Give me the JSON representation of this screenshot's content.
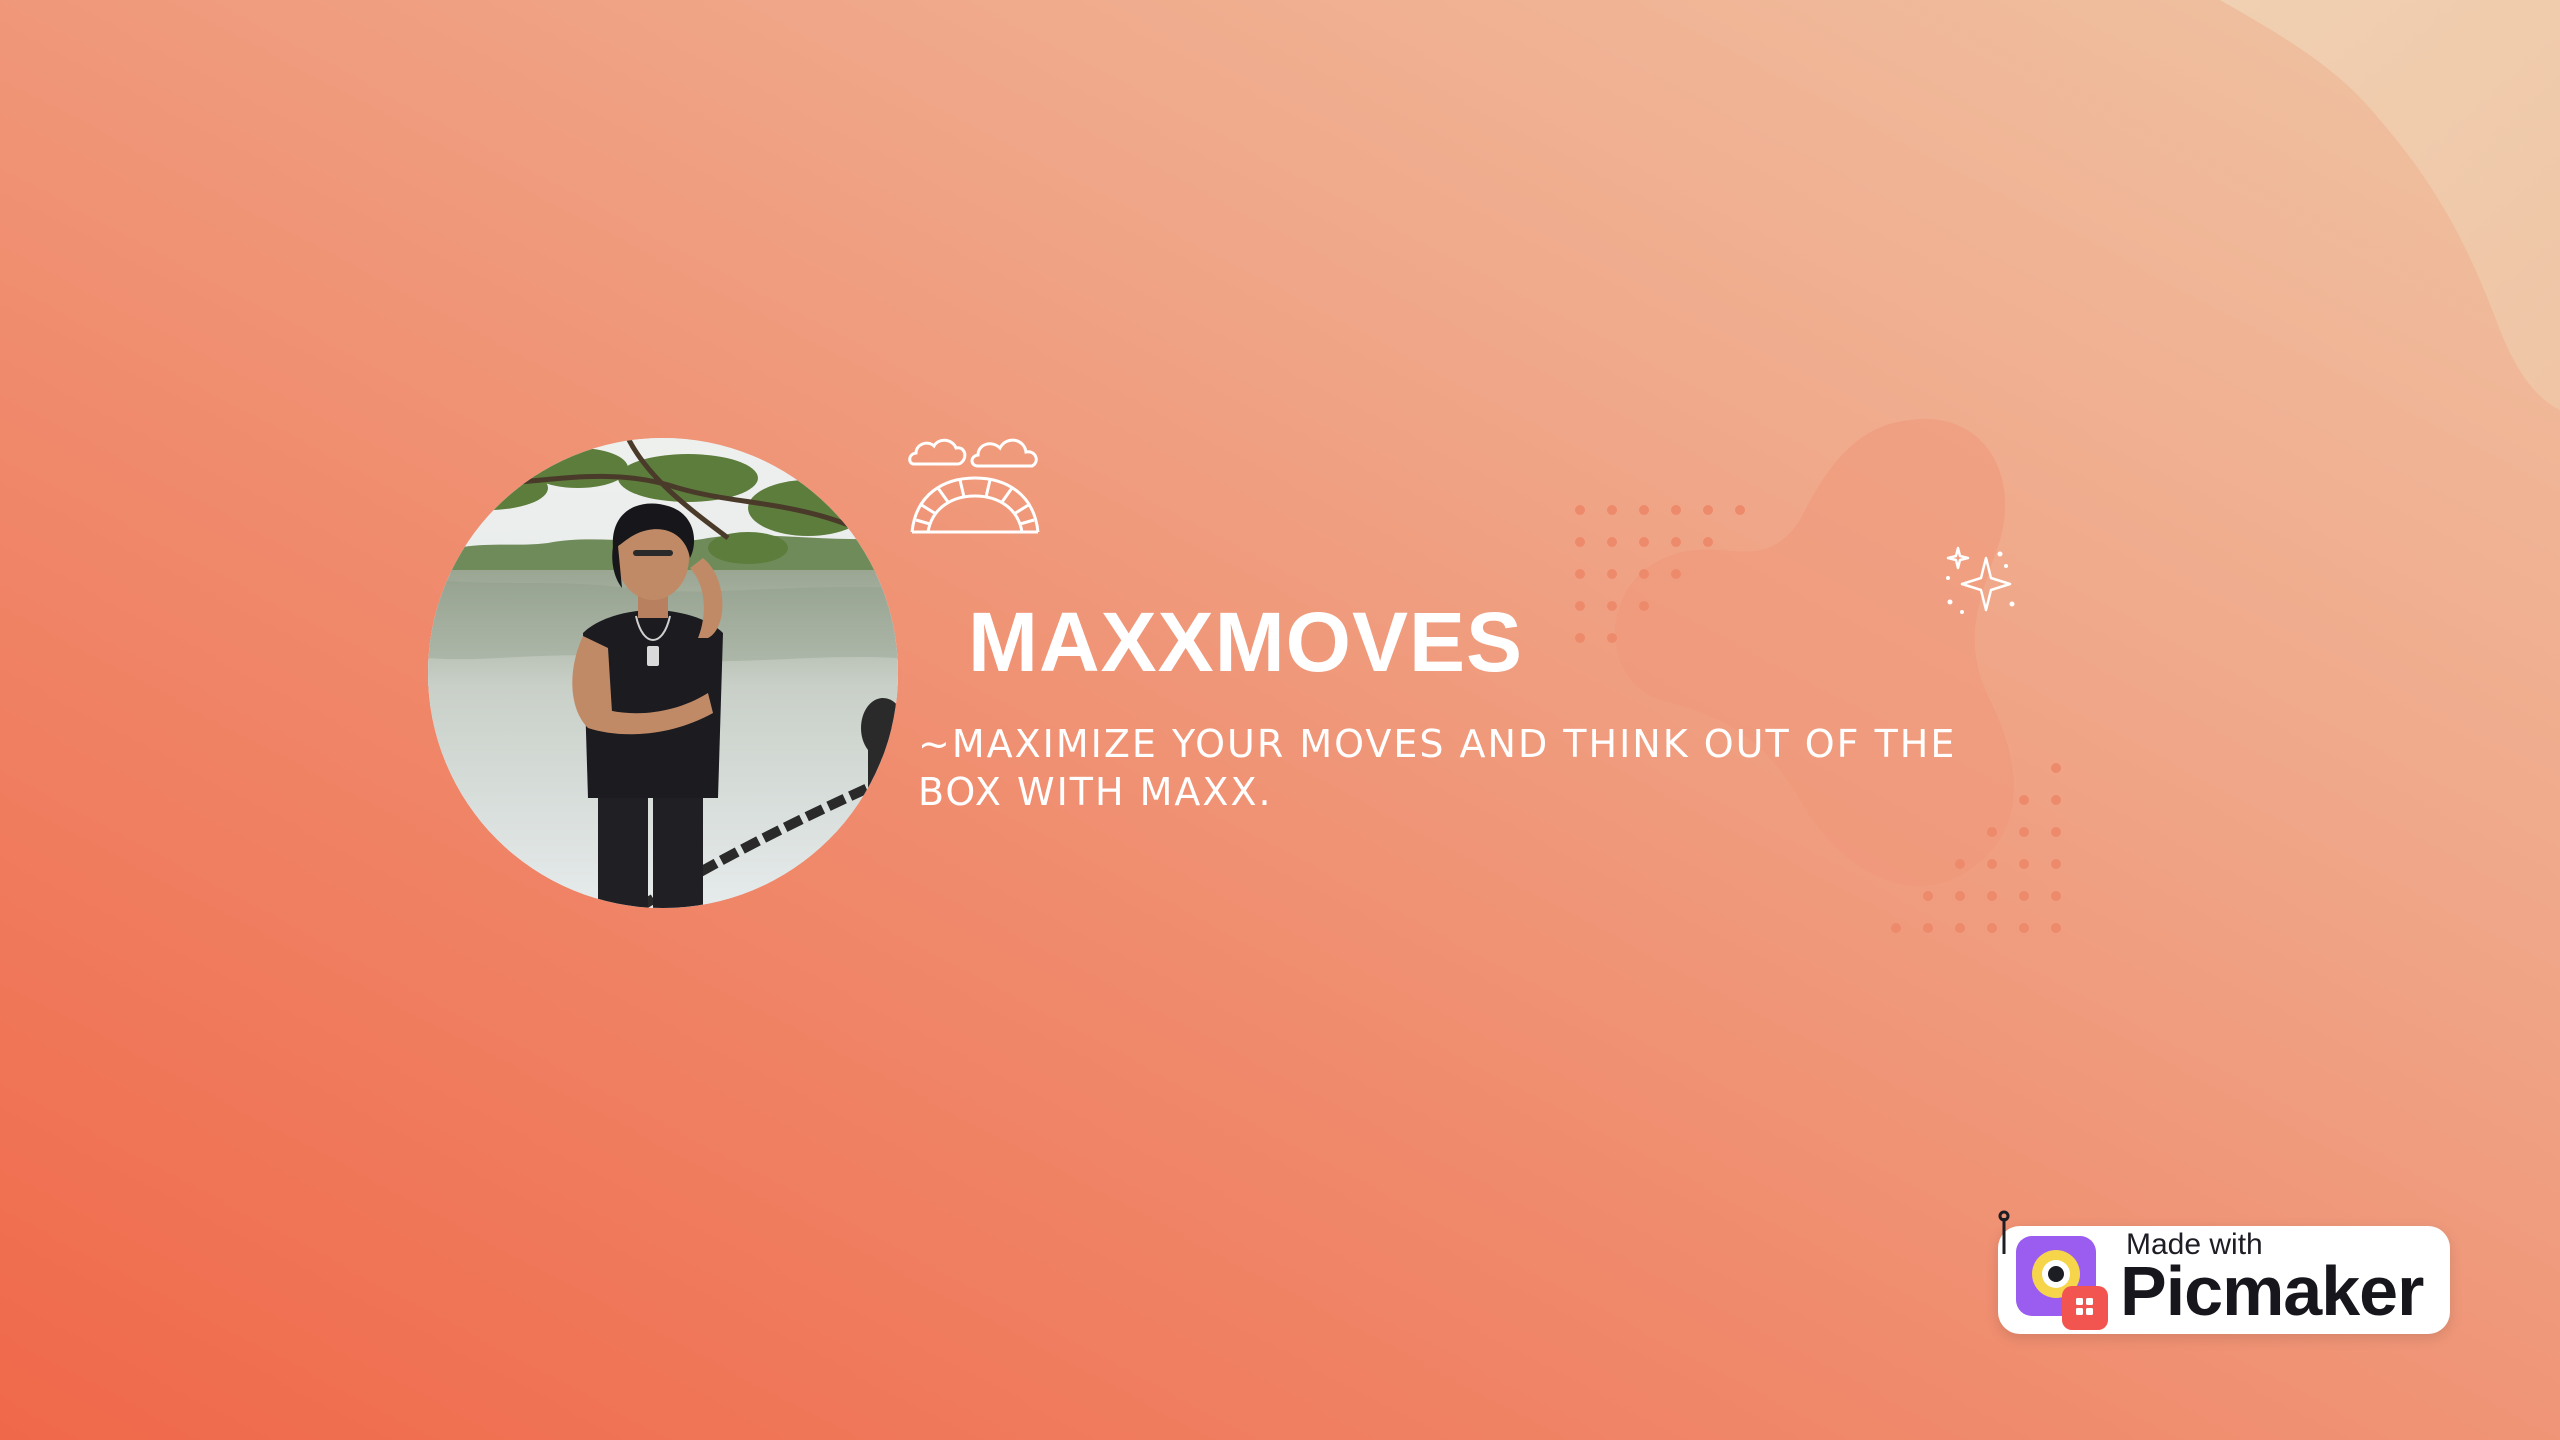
{
  "banner": {
    "title": "MAXXMOVES",
    "tagline": "~MAXIMIZE YOUR MOVES AND THINK OUT OF THE BOX WITH MAXX."
  },
  "watermark": {
    "small_text": "Made with",
    "brand_text": "Picmaker"
  },
  "icons": {
    "clouds": "clouds-icon",
    "bridge": "bridge-icon",
    "sparkles": "sparkles-icon",
    "logo": "picmaker-logo-icon"
  },
  "colors": {
    "gradient_start": "#f0684a",
    "gradient_end": "#efc4a3",
    "text": "#ffffff",
    "logo_purple": "#9b5cf0",
    "logo_red": "#f2544f"
  }
}
